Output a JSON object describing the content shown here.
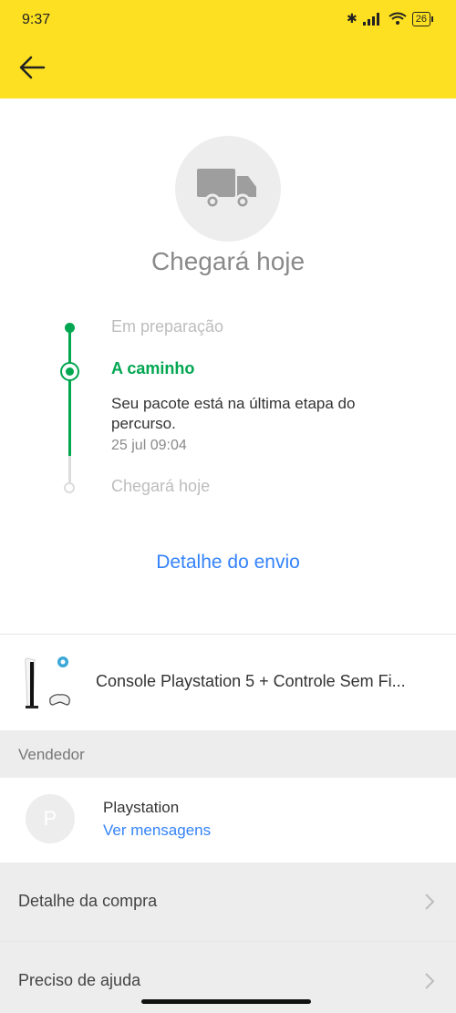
{
  "status_bar": {
    "time": "9:37",
    "battery": "26"
  },
  "hero": {
    "title": "Chegará hoje"
  },
  "timeline": {
    "steps": [
      {
        "label": "Em preparação",
        "state": "done"
      },
      {
        "label": "A caminho",
        "state": "current",
        "description": "Seu pacote está na última etapa do percurso.",
        "date": "25 jul 09:04"
      },
      {
        "label": "Chegará hoje",
        "state": "pending"
      }
    ]
  },
  "shipping_link": "Detalhe do envio",
  "product": {
    "name": "Console Playstation 5 + Controle Sem Fi..."
  },
  "seller": {
    "section_label": "Vendedor",
    "avatar_letter": "P",
    "name": "Playstation",
    "messages_link": "Ver mensagens"
  },
  "rows": [
    {
      "label": "Detalhe da compra"
    },
    {
      "label": "Preciso de ajuda"
    }
  ],
  "colors": {
    "brand_yellow": "#fde021",
    "accent_green": "#00a650",
    "link_blue": "#3483fa"
  }
}
